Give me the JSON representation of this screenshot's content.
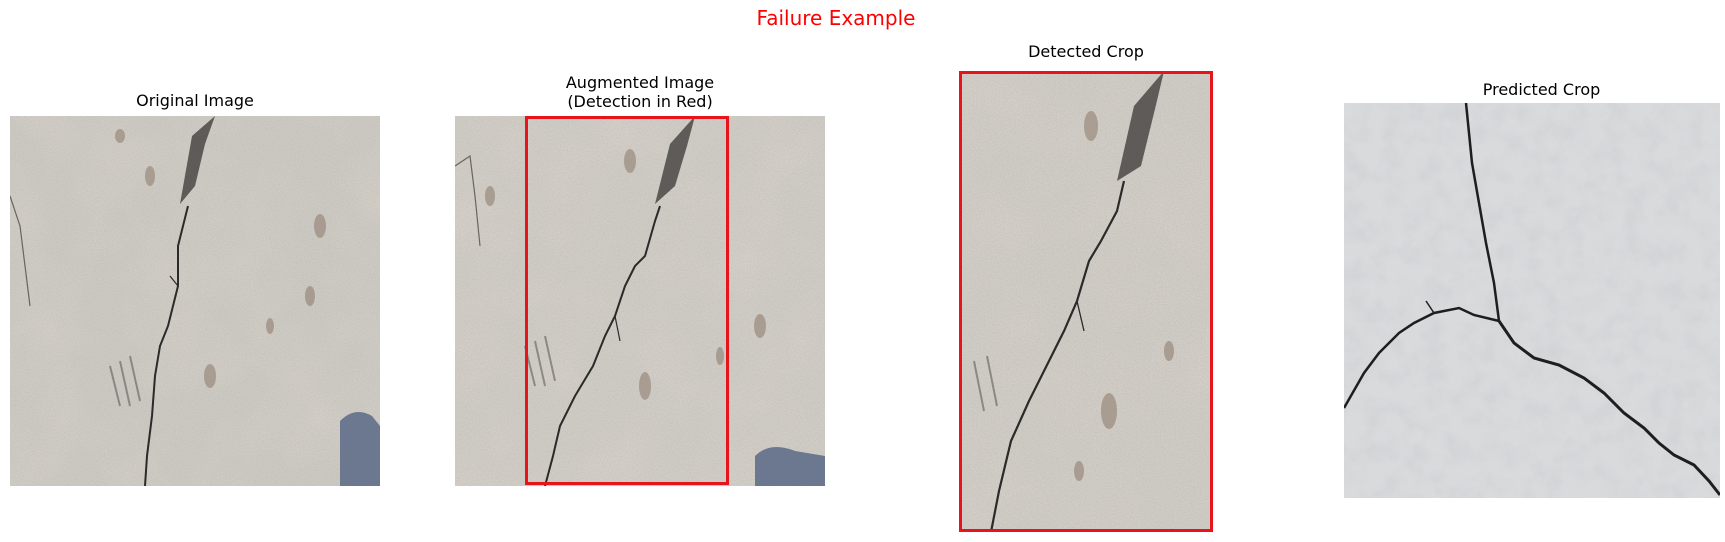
{
  "figure": {
    "suptitle": "Failure Example",
    "suptitle_color": "#ff0000",
    "detection_color": "#e8141c"
  },
  "panels": [
    {
      "title": "Original Image",
      "content": "concrete surface with a single diagonal crack and a chipped gap near the top"
    },
    {
      "title": "Augmented Image\n(Detection in Red)",
      "content": "horizontally shifted copy of the concrete surface with a red detection box"
    },
    {
      "title": "Detected Crop",
      "content": "tall crop of the concrete surface inside the red detection box"
    },
    {
      "title": "Predicted Crop",
      "content": "smooth grey plaster wall with branching cracks"
    }
  ]
}
